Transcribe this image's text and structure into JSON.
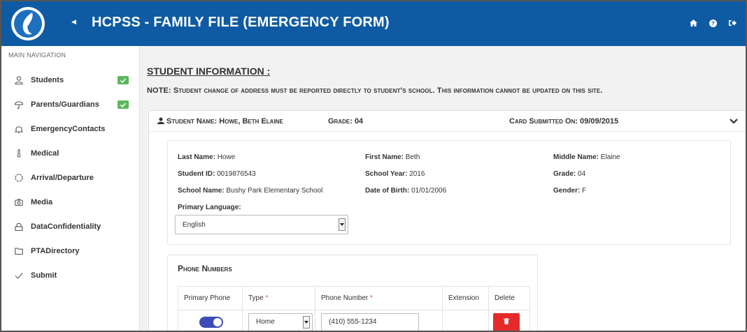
{
  "header": {
    "title": "HCPSS - FAMILY FILE (EMERGENCY FORM)",
    "icons": [
      "home-icon",
      "help-icon",
      "sign-out-icon"
    ]
  },
  "sidebar": {
    "heading": "MAIN NAVIGATION",
    "items": [
      {
        "label": "Students",
        "icon": "user-icon",
        "complete": true
      },
      {
        "label": "Parents/Guardians",
        "icon": "umbrella-icon",
        "complete": true
      },
      {
        "label": "EmergencyContacts",
        "icon": "bell-icon",
        "complete": false
      },
      {
        "label": "Medical",
        "icon": "thermometer-icon",
        "complete": false
      },
      {
        "label": "Arrival/Departure",
        "icon": "clock-icon",
        "complete": false
      },
      {
        "label": "Media",
        "icon": "camera-icon",
        "complete": false
      },
      {
        "label": "DataConfidentiality",
        "icon": "lock-icon",
        "complete": false
      },
      {
        "label": "PTADirectory",
        "icon": "folder-icon",
        "complete": false
      },
      {
        "label": "Submit",
        "icon": "check-icon",
        "complete": false
      }
    ]
  },
  "main": {
    "section_title": "STUDENT INFORMATION :",
    "note": "NOTE: Student change of address must be reported directly to student's school. This information cannot be updated on this site.",
    "card": {
      "student_name": "Student Name: Howe, Beth Elaine",
      "grade": "Grade: 04",
      "card_submitted": "Card Submitted On: 09/09/2015"
    },
    "details": {
      "last_name_label": "Last Name:",
      "last_name": "Howe",
      "first_name_label": "First Name:",
      "first_name": "Beth",
      "middle_name_label": "Middle Name:",
      "middle_name": "Elaine",
      "student_id_label": "Student ID:",
      "student_id": "0019876543",
      "school_year_label": "School Year:",
      "school_year": "2016",
      "grade_label": "Grade:",
      "grade": "04",
      "school_name_label": "School Name:",
      "school_name": "Bushy Park Elementary School",
      "dob_label": "Date of Birth:",
      "dob": "01/01/2006",
      "gender_label": "Gender:",
      "gender": "F",
      "primary_language_label": "Primary Language:",
      "primary_language": "English"
    },
    "phones": {
      "title": "Phone Numbers",
      "columns": [
        "Primary Phone",
        "Type",
        "Phone Number",
        "Extension",
        "Delete"
      ],
      "rows": [
        {
          "primary": true,
          "type": "Home",
          "number": "(410) 555-1234",
          "extension": ""
        }
      ]
    }
  },
  "colors": {
    "header": "#0e5ba3",
    "complete_badge": "#5cb85c",
    "delete_button": "#e52a2a",
    "toggle_on": "#3d4db8",
    "required": "#d9534f"
  }
}
